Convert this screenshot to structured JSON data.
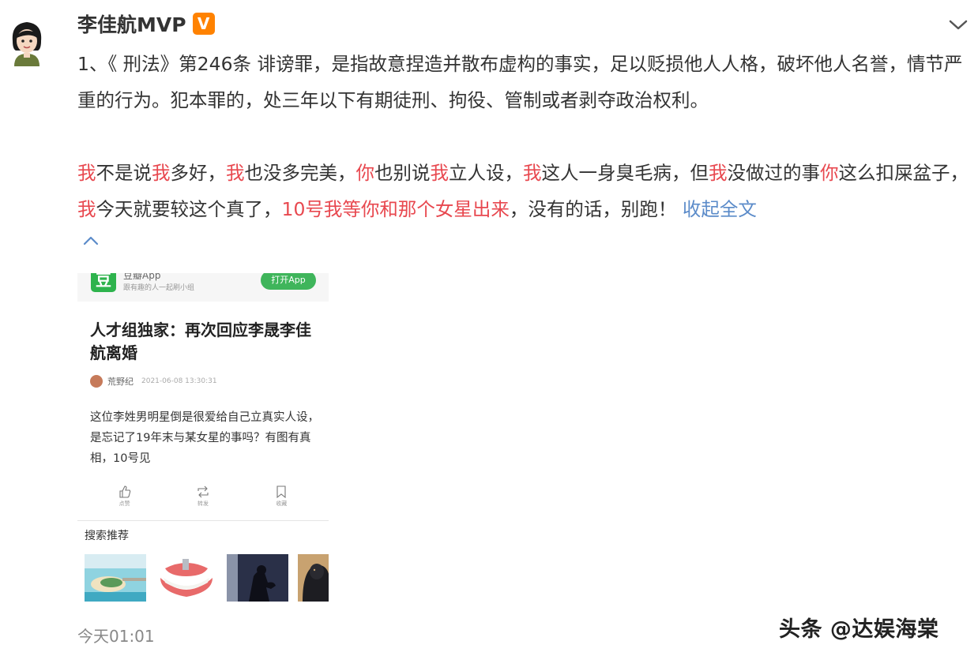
{
  "post": {
    "username": "李佳航MVP",
    "badge": "V",
    "line1": "1、《 刑法》第246条 诽谤罪，是指故意捏造并散布虚构的事实，足以贬损他人人格，破坏他人名誉，情节严重的行为。犯本罪的，处三年以下有期徒刑、拘役、管制或者剥夺政治权利。",
    "p2": {
      "s1": "我",
      "s2": "不是说",
      "s3": "我",
      "s4": "多好，",
      "s5": "我",
      "s6": "也没多完美，",
      "s7": "你",
      "s8": "也别说",
      "s9": "我",
      "s10": "立人设，",
      "s11": "我",
      "s12": "这人一身臭毛病，但",
      "s13": "我",
      "s14": "没做过的事",
      "s15": "你",
      "s16": "这么扣屎盆子，",
      "s17": "我",
      "s18": "今天就要较这个真了，",
      "s19": "10号我等你和那个女星出来",
      "s20": "，没有的话，别跑！ "
    },
    "collapse_label": "收起全文",
    "timestamp": "今天01:01"
  },
  "embedded": {
    "app_icon": "豆",
    "app_name": "豆瓣App",
    "app_sub": "跟有趣的人一起刷小组",
    "open_button": "打开App",
    "title": "人才组独家：再次回应李晟李佳航离婚",
    "author": "荒野纪",
    "time": "2021-06-08 13:30:31",
    "body": "这位李姓男明星倒是很爱给自己立真实人设，是忘记了19年末与某女星的事吗？有图有真相，10号见",
    "actions": [
      "点赞",
      "转发",
      "收藏"
    ],
    "search_rec": "搜索推荐"
  },
  "watermark": "头条 @达娱海棠",
  "colors": {
    "highlight": "#e8484f",
    "link": "#5b8bc9",
    "vip_badge": "#ff8200",
    "douban_green": "#2eb34d"
  },
  "icons": [
    "avatar",
    "chevron-down-icon",
    "chevron-up-icon",
    "like-icon",
    "repost-icon",
    "bookmark-icon"
  ]
}
